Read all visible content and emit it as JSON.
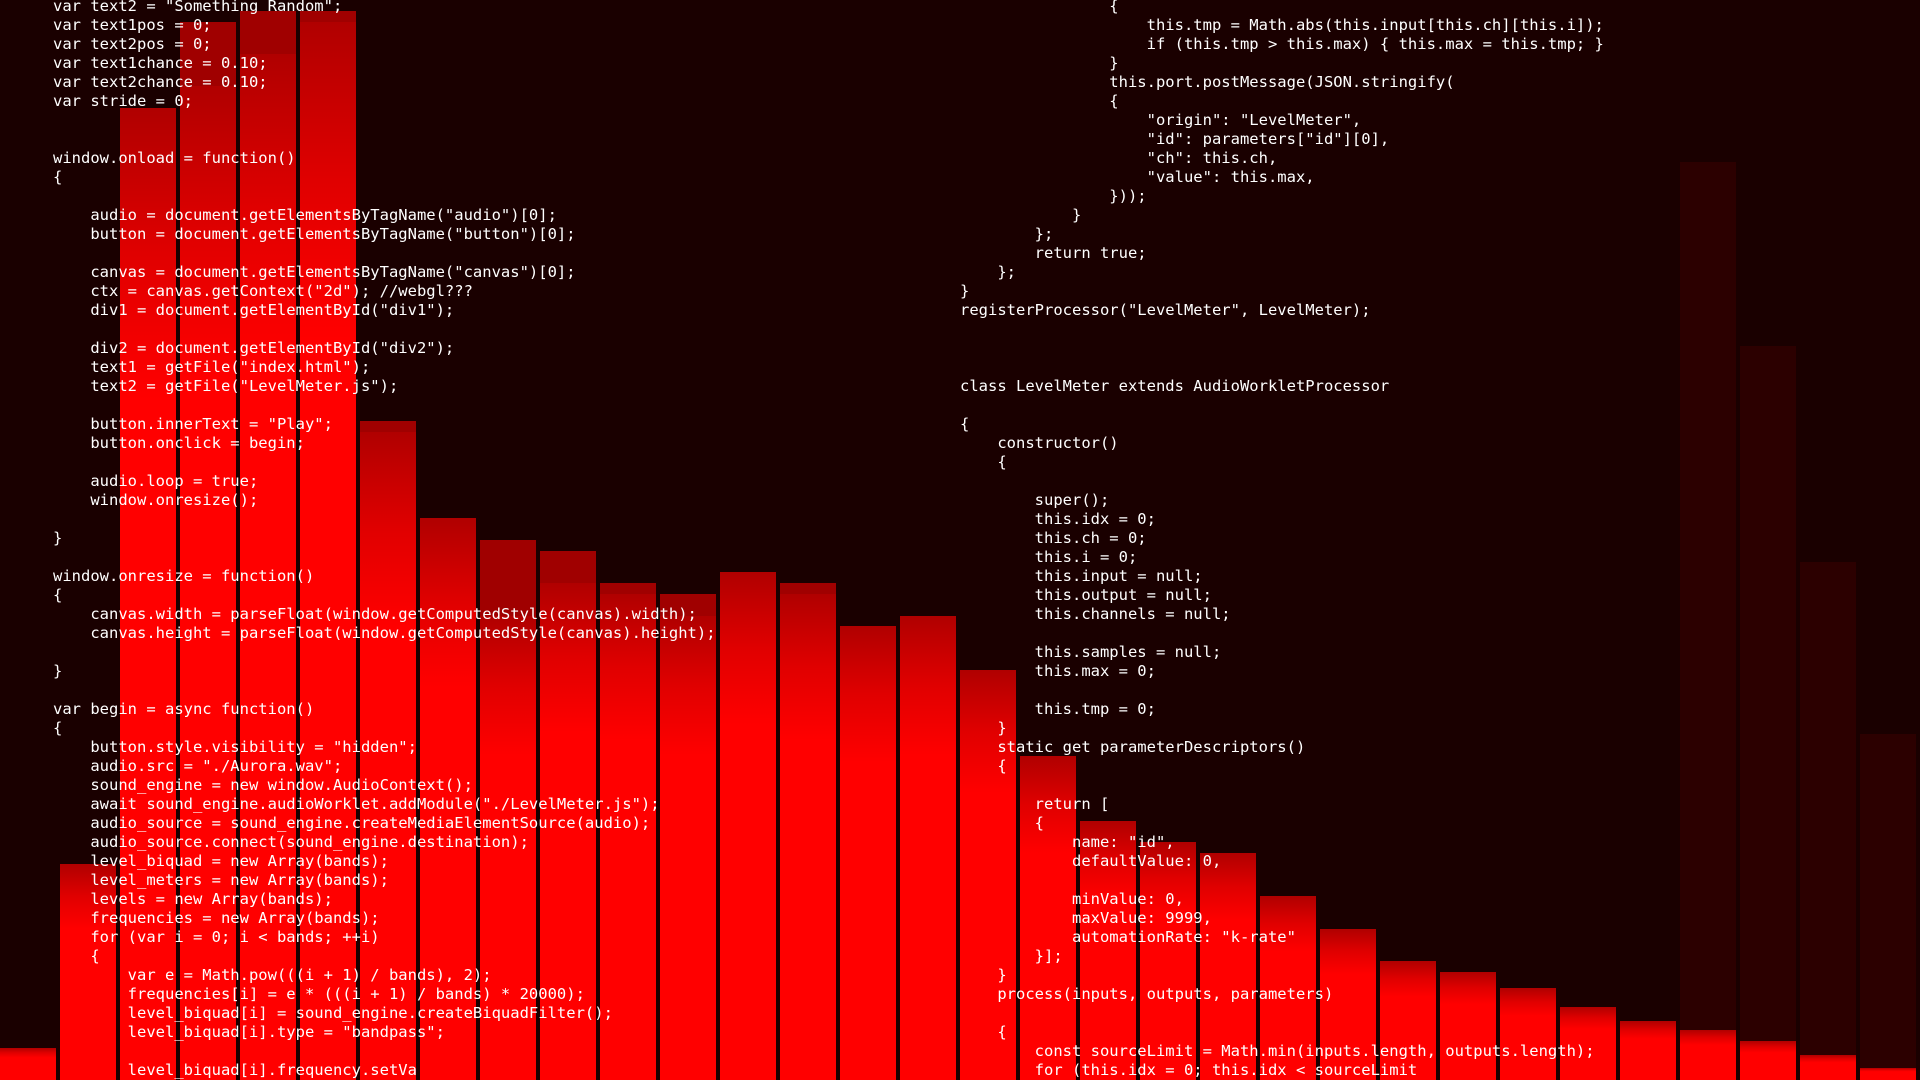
{
  "theme": {
    "background": "#1a0000",
    "bar_bright": "#ff0000",
    "bar_mid": "#e00000",
    "bar_dim": "#b00000",
    "peak": "#a00000",
    "bar_dark": "#2c0000",
    "text": "#ffffff"
  },
  "visualizer": {
    "band_count": 32,
    "levels": [
      0.03,
      0.2,
      0.9,
      0.92,
      0.95,
      0.98,
      0.6,
      0.52,
      0.43,
      0.46,
      0.45,
      0.43,
      0.47,
      0.45,
      0.42,
      0.43,
      0.38,
      0.3,
      0.24,
      0.22,
      0.21,
      0.17,
      0.14,
      0.11,
      0.1,
      0.085,
      0.068,
      0.055,
      0.046,
      0.036,
      0.023,
      0.011
    ],
    "peaks": [
      0.02,
      0.2,
      0.66,
      0.98,
      0.99,
      0.99,
      0.61,
      0.52,
      0.5,
      0.49,
      0.46,
      0.45,
      0.47,
      0.46,
      0.42,
      0.43,
      0.36,
      0.28,
      0.24,
      0.21,
      0.21,
      0.17,
      0.14,
      0.11,
      0.1,
      0.085,
      0.068,
      0.055,
      0.046,
      0.036,
      0.023,
      0.011
    ],
    "ghost": [
      0.0,
      0.0,
      0.0,
      0.0,
      0.0,
      0.0,
      0.0,
      0.0,
      0.0,
      0.0,
      0.0,
      0.0,
      0.0,
      0.0,
      0.0,
      0.0,
      0.0,
      0.0,
      0.0,
      0.0,
      0.0,
      0.0,
      0.0,
      0.0,
      0.0,
      0.0,
      0.0,
      0.0,
      0.85,
      0.68,
      0.48,
      0.32
    ]
  },
  "code_left": [
    "var text2 = \"Something Random\";",
    "var text1pos = 0;",
    "var text2pos = 0;",
    "var text1chance = 0.10;",
    "var text2chance = 0.10;",
    "var stride = 0;",
    "",
    "",
    "window.onload = function()",
    "{",
    "",
    "    audio = document.getElementsByTagName(\"audio\")[0];",
    "    button = document.getElementsByTagName(\"button\")[0];",
    "",
    "    canvas = document.getElementsByTagName(\"canvas\")[0];",
    "    ctx = canvas.getContext(\"2d\"); //webgl???",
    "    div1 = document.getElementById(\"div1\");",
    "",
    "    div2 = document.getElementById(\"div2\");",
    "    text1 = getFile(\"index.html\");",
    "    text2 = getFile(\"LevelMeter.js\");",
    "",
    "    button.innerText = \"Play\";",
    "    button.onclick = begin;",
    "",
    "    audio.loop = true;",
    "    window.onresize();",
    "",
    "}",
    "",
    "window.onresize = function()",
    "{",
    "    canvas.width = parseFloat(window.getComputedStyle(canvas).width);",
    "    canvas.height = parseFloat(window.getComputedStyle(canvas).height);",
    "",
    "}",
    "",
    "var begin = async function()",
    "{",
    "    button.style.visibility = \"hidden\";",
    "    audio.src = \"./Aurora.wav\";",
    "    sound_engine = new window.AudioContext();",
    "    await sound_engine.audioWorklet.addModule(\"./LevelMeter.js\");",
    "    audio_source = sound_engine.createMediaElementSource(audio);",
    "    audio_source.connect(sound_engine.destination);",
    "    level_biquad = new Array(bands);",
    "    level_meters = new Array(bands);",
    "    levels = new Array(bands);",
    "    frequencies = new Array(bands);",
    "    for (var i = 0; i < bands; ++i)",
    "    {",
    "        var e = Math.pow(((i + 1) / bands), 2);",
    "        frequencies[i] = e * (((i + 1) / bands) * 20000);",
    "        level_biquad[i] = sound_engine.createBiquadFilter();",
    "        level_biquad[i].type = \"bandpass\";",
    "",
    "        level_biquad[i].frequency.setVa"
  ],
  "code_right": [
    "                {",
    "                    this.tmp = Math.abs(this.input[this.ch][this.i]);",
    "                    if (this.tmp > this.max) { this.max = this.tmp; }",
    "                }",
    "                this.port.postMessage(JSON.stringify(",
    "                {",
    "                    \"origin\": \"LevelMeter\",",
    "                    \"id\": parameters[\"id\"][0],",
    "                    \"ch\": this.ch,",
    "                    \"value\": this.max,",
    "                }));",
    "            }",
    "        };",
    "        return true;",
    "    };",
    "}",
    "registerProcessor(\"LevelMeter\", LevelMeter);",
    "",
    "",
    "",
    "class LevelMeter extends AudioWorkletProcessor",
    "",
    "{",
    "    constructor()",
    "    {",
    "",
    "        super();",
    "        this.idx = 0;",
    "        this.ch = 0;",
    "        this.i = 0;",
    "        this.input = null;",
    "        this.output = null;",
    "        this.channels = null;",
    "",
    "        this.samples = null;",
    "        this.max = 0;",
    "",
    "        this.tmp = 0;",
    "    }",
    "    static get parameterDescriptors()",
    "    {",
    "",
    "        return [",
    "        {",
    "            name: \"id\",",
    "            defaultValue: 0,",
    "",
    "            minValue: 0,",
    "            maxValue: 9999,",
    "            automationRate: \"k-rate\"",
    "        }];",
    "    }",
    "    process(inputs, outputs, parameters)",
    "",
    "    {",
    "        const sourceLimit = Math.min(inputs.length, outputs.length);",
    "        for (this.idx = 0; this.idx < sourceLimit"
  ]
}
